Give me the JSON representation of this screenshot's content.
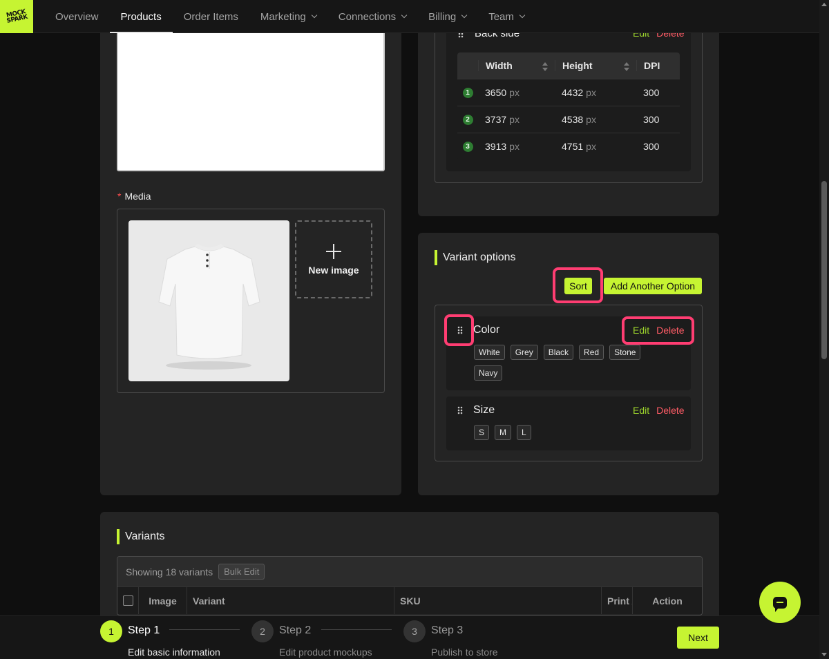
{
  "logo": {
    "text": "MOCK SPARK"
  },
  "nav": {
    "items": [
      {
        "label": "Overview",
        "dropdown": false
      },
      {
        "label": "Products",
        "dropdown": false,
        "active": true
      },
      {
        "label": "Order Items",
        "dropdown": false
      },
      {
        "label": "Marketing",
        "dropdown": true
      },
      {
        "label": "Connections",
        "dropdown": true
      },
      {
        "label": "Billing",
        "dropdown": true
      },
      {
        "label": "Team",
        "dropdown": true
      }
    ]
  },
  "media": {
    "label": "Media",
    "required_mark": "*",
    "new_image_label": "New image"
  },
  "print_area": {
    "name": "Back side",
    "edit": "Edit",
    "delete": "Delete",
    "columns": [
      "Width",
      "Height",
      "DPI"
    ],
    "unit": "px",
    "rows": [
      {
        "n": "1",
        "width": "3650",
        "height": "4432",
        "dpi": "300"
      },
      {
        "n": "2",
        "width": "3737",
        "height": "4538",
        "dpi": "300"
      },
      {
        "n": "3",
        "width": "3913",
        "height": "4751",
        "dpi": "300"
      }
    ]
  },
  "variant_options": {
    "title": "Variant options",
    "sort_label": "Sort",
    "add_label": "Add Another Option",
    "options": [
      {
        "name": "Color",
        "edit": "Edit",
        "delete": "Delete",
        "values": [
          "White",
          "Grey",
          "Black",
          "Red",
          "Stone",
          "Navy"
        ]
      },
      {
        "name": "Size",
        "edit": "Edit",
        "delete": "Delete",
        "values": [
          "S",
          "M",
          "L"
        ]
      }
    ]
  },
  "variants": {
    "title": "Variants",
    "showing": "Showing 18 variants",
    "bulk_edit": "Bulk Edit",
    "columns": [
      "Image",
      "Variant",
      "SKU",
      "Print A",
      "Action"
    ]
  },
  "steps": [
    {
      "num": "1",
      "title": "Step 1",
      "desc": "Edit basic information",
      "active": true
    },
    {
      "num": "2",
      "title": "Step 2",
      "desc": "Edit product mockups",
      "active": false
    },
    {
      "num": "3",
      "title": "Step 3",
      "desc": "Publish to store",
      "active": false
    }
  ],
  "next_label": "Next",
  "colors": {
    "accent": "#c6f432",
    "danger": "#ff5c66",
    "highlight": "#ff3d72",
    "edit": "#9bd22c"
  }
}
